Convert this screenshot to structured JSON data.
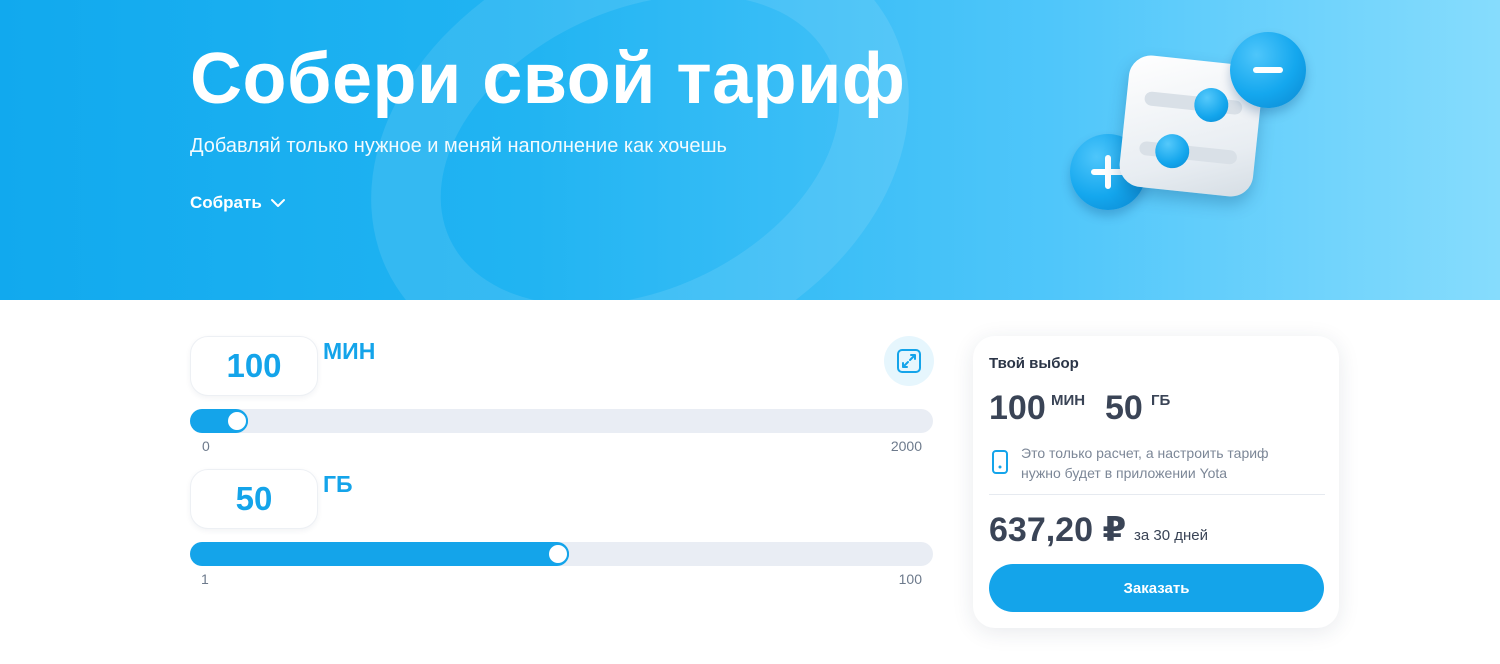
{
  "hero": {
    "title": "Собери свой тариф",
    "subtitle": "Добавляй только нужное и меняй наполнение как хочешь",
    "collect_label": "Собрать"
  },
  "minutes": {
    "value": "100",
    "unit": "МИН",
    "min_label": "0",
    "max_label": "2000",
    "min": 0,
    "max": 2000,
    "current": 100
  },
  "gigabytes": {
    "value": "50",
    "unit": "ГБ",
    "min_label": "1",
    "max_label": "100",
    "min": 1,
    "max": 100,
    "current": 50
  },
  "summary": {
    "title": "Твой выбор",
    "minutes_value": "100",
    "minutes_unit": "МИН",
    "gb_value": "50",
    "gb_unit": "ГБ",
    "note_line1": "Это только расчет, а настроить тариф",
    "note_line2": "нужно будет в приложении Yota",
    "price": "637,20 ₽",
    "period": "за 30 дней",
    "order_label": "Заказать"
  },
  "icons": {
    "expand": "expand-icon",
    "phone": "phone-icon",
    "chevron": "chevron-down-icon"
  },
  "colors": {
    "accent": "#14a4ea",
    "hero_start": "#11a9ee",
    "hero_end": "#86dcfd",
    "text_dark": "#3a4456",
    "track": "#e9edf4"
  }
}
